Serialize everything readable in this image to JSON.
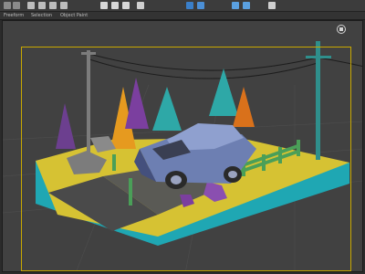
{
  "toolbar": {
    "icons": [
      "undo-icon",
      "redo-icon",
      "select-icon",
      "move-icon",
      "rotate-icon",
      "scale-icon",
      "snap-icon",
      "angle-snap-icon",
      "percent-snap-icon",
      "mirror-icon",
      "align-icon",
      "layer-icon",
      "render-setup-icon",
      "render-icon",
      "material-editor-icon"
    ]
  },
  "ribbon": {
    "tabs": [
      "Freeform",
      "Selection",
      "Object Paint"
    ]
  },
  "viewport": {
    "label": "",
    "safe_frame_color": "#c8a800"
  },
  "colors": {
    "background": "#414141",
    "grass": "#d6c233",
    "water": "#1fa7b3",
    "road": "#4a4a4a",
    "car": "#6d7fb2",
    "car_dark": "#44507d",
    "tree_teal": "#2ea8a7",
    "tree_orange": "#e69a1f",
    "tree_purple": "#7b3f9f",
    "rock": "#7c7c7c",
    "fence": "#4a9f58",
    "pole": "#2f8f8c"
  }
}
